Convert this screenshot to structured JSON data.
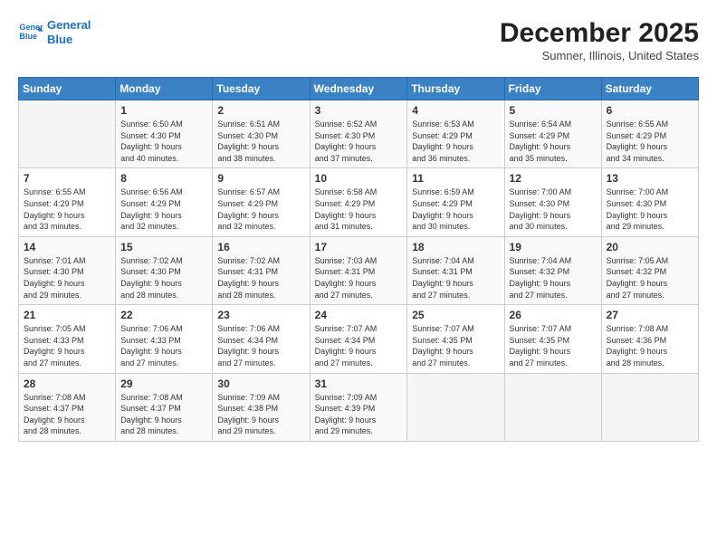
{
  "header": {
    "logo_line1": "General",
    "logo_line2": "Blue",
    "month": "December 2025",
    "location": "Sumner, Illinois, United States"
  },
  "days_of_week": [
    "Sunday",
    "Monday",
    "Tuesday",
    "Wednesday",
    "Thursday",
    "Friday",
    "Saturday"
  ],
  "weeks": [
    [
      {
        "day": "",
        "content": ""
      },
      {
        "day": "1",
        "content": "Sunrise: 6:50 AM\nSunset: 4:30 PM\nDaylight: 9 hours\nand 40 minutes."
      },
      {
        "day": "2",
        "content": "Sunrise: 6:51 AM\nSunset: 4:30 PM\nDaylight: 9 hours\nand 38 minutes."
      },
      {
        "day": "3",
        "content": "Sunrise: 6:52 AM\nSunset: 4:30 PM\nDaylight: 9 hours\nand 37 minutes."
      },
      {
        "day": "4",
        "content": "Sunrise: 6:53 AM\nSunset: 4:29 PM\nDaylight: 9 hours\nand 36 minutes."
      },
      {
        "day": "5",
        "content": "Sunrise: 6:54 AM\nSunset: 4:29 PM\nDaylight: 9 hours\nand 35 minutes."
      },
      {
        "day": "6",
        "content": "Sunrise: 6:55 AM\nSunset: 4:29 PM\nDaylight: 9 hours\nand 34 minutes."
      }
    ],
    [
      {
        "day": "7",
        "content": "Sunrise: 6:55 AM\nSunset: 4:29 PM\nDaylight: 9 hours\nand 33 minutes."
      },
      {
        "day": "8",
        "content": "Sunrise: 6:56 AM\nSunset: 4:29 PM\nDaylight: 9 hours\nand 32 minutes."
      },
      {
        "day": "9",
        "content": "Sunrise: 6:57 AM\nSunset: 4:29 PM\nDaylight: 9 hours\nand 32 minutes."
      },
      {
        "day": "10",
        "content": "Sunrise: 6:58 AM\nSunset: 4:29 PM\nDaylight: 9 hours\nand 31 minutes."
      },
      {
        "day": "11",
        "content": "Sunrise: 6:59 AM\nSunset: 4:29 PM\nDaylight: 9 hours\nand 30 minutes."
      },
      {
        "day": "12",
        "content": "Sunrise: 7:00 AM\nSunset: 4:30 PM\nDaylight: 9 hours\nand 30 minutes."
      },
      {
        "day": "13",
        "content": "Sunrise: 7:00 AM\nSunset: 4:30 PM\nDaylight: 9 hours\nand 29 minutes."
      }
    ],
    [
      {
        "day": "14",
        "content": "Sunrise: 7:01 AM\nSunset: 4:30 PM\nDaylight: 9 hours\nand 29 minutes."
      },
      {
        "day": "15",
        "content": "Sunrise: 7:02 AM\nSunset: 4:30 PM\nDaylight: 9 hours\nand 28 minutes."
      },
      {
        "day": "16",
        "content": "Sunrise: 7:02 AM\nSunset: 4:31 PM\nDaylight: 9 hours\nand 28 minutes."
      },
      {
        "day": "17",
        "content": "Sunrise: 7:03 AM\nSunset: 4:31 PM\nDaylight: 9 hours\nand 27 minutes."
      },
      {
        "day": "18",
        "content": "Sunrise: 7:04 AM\nSunset: 4:31 PM\nDaylight: 9 hours\nand 27 minutes."
      },
      {
        "day": "19",
        "content": "Sunrise: 7:04 AM\nSunset: 4:32 PM\nDaylight: 9 hours\nand 27 minutes."
      },
      {
        "day": "20",
        "content": "Sunrise: 7:05 AM\nSunset: 4:32 PM\nDaylight: 9 hours\nand 27 minutes."
      }
    ],
    [
      {
        "day": "21",
        "content": "Sunrise: 7:05 AM\nSunset: 4:33 PM\nDaylight: 9 hours\nand 27 minutes."
      },
      {
        "day": "22",
        "content": "Sunrise: 7:06 AM\nSunset: 4:33 PM\nDaylight: 9 hours\nand 27 minutes."
      },
      {
        "day": "23",
        "content": "Sunrise: 7:06 AM\nSunset: 4:34 PM\nDaylight: 9 hours\nand 27 minutes."
      },
      {
        "day": "24",
        "content": "Sunrise: 7:07 AM\nSunset: 4:34 PM\nDaylight: 9 hours\nand 27 minutes."
      },
      {
        "day": "25",
        "content": "Sunrise: 7:07 AM\nSunset: 4:35 PM\nDaylight: 9 hours\nand 27 minutes."
      },
      {
        "day": "26",
        "content": "Sunrise: 7:07 AM\nSunset: 4:35 PM\nDaylight: 9 hours\nand 27 minutes."
      },
      {
        "day": "27",
        "content": "Sunrise: 7:08 AM\nSunset: 4:36 PM\nDaylight: 9 hours\nand 28 minutes."
      }
    ],
    [
      {
        "day": "28",
        "content": "Sunrise: 7:08 AM\nSunset: 4:37 PM\nDaylight: 9 hours\nand 28 minutes."
      },
      {
        "day": "29",
        "content": "Sunrise: 7:08 AM\nSunset: 4:37 PM\nDaylight: 9 hours\nand 28 minutes."
      },
      {
        "day": "30",
        "content": "Sunrise: 7:09 AM\nSunset: 4:38 PM\nDaylight: 9 hours\nand 29 minutes."
      },
      {
        "day": "31",
        "content": "Sunrise: 7:09 AM\nSunset: 4:39 PM\nDaylight: 9 hours\nand 29 minutes."
      },
      {
        "day": "",
        "content": ""
      },
      {
        "day": "",
        "content": ""
      },
      {
        "day": "",
        "content": ""
      }
    ]
  ]
}
